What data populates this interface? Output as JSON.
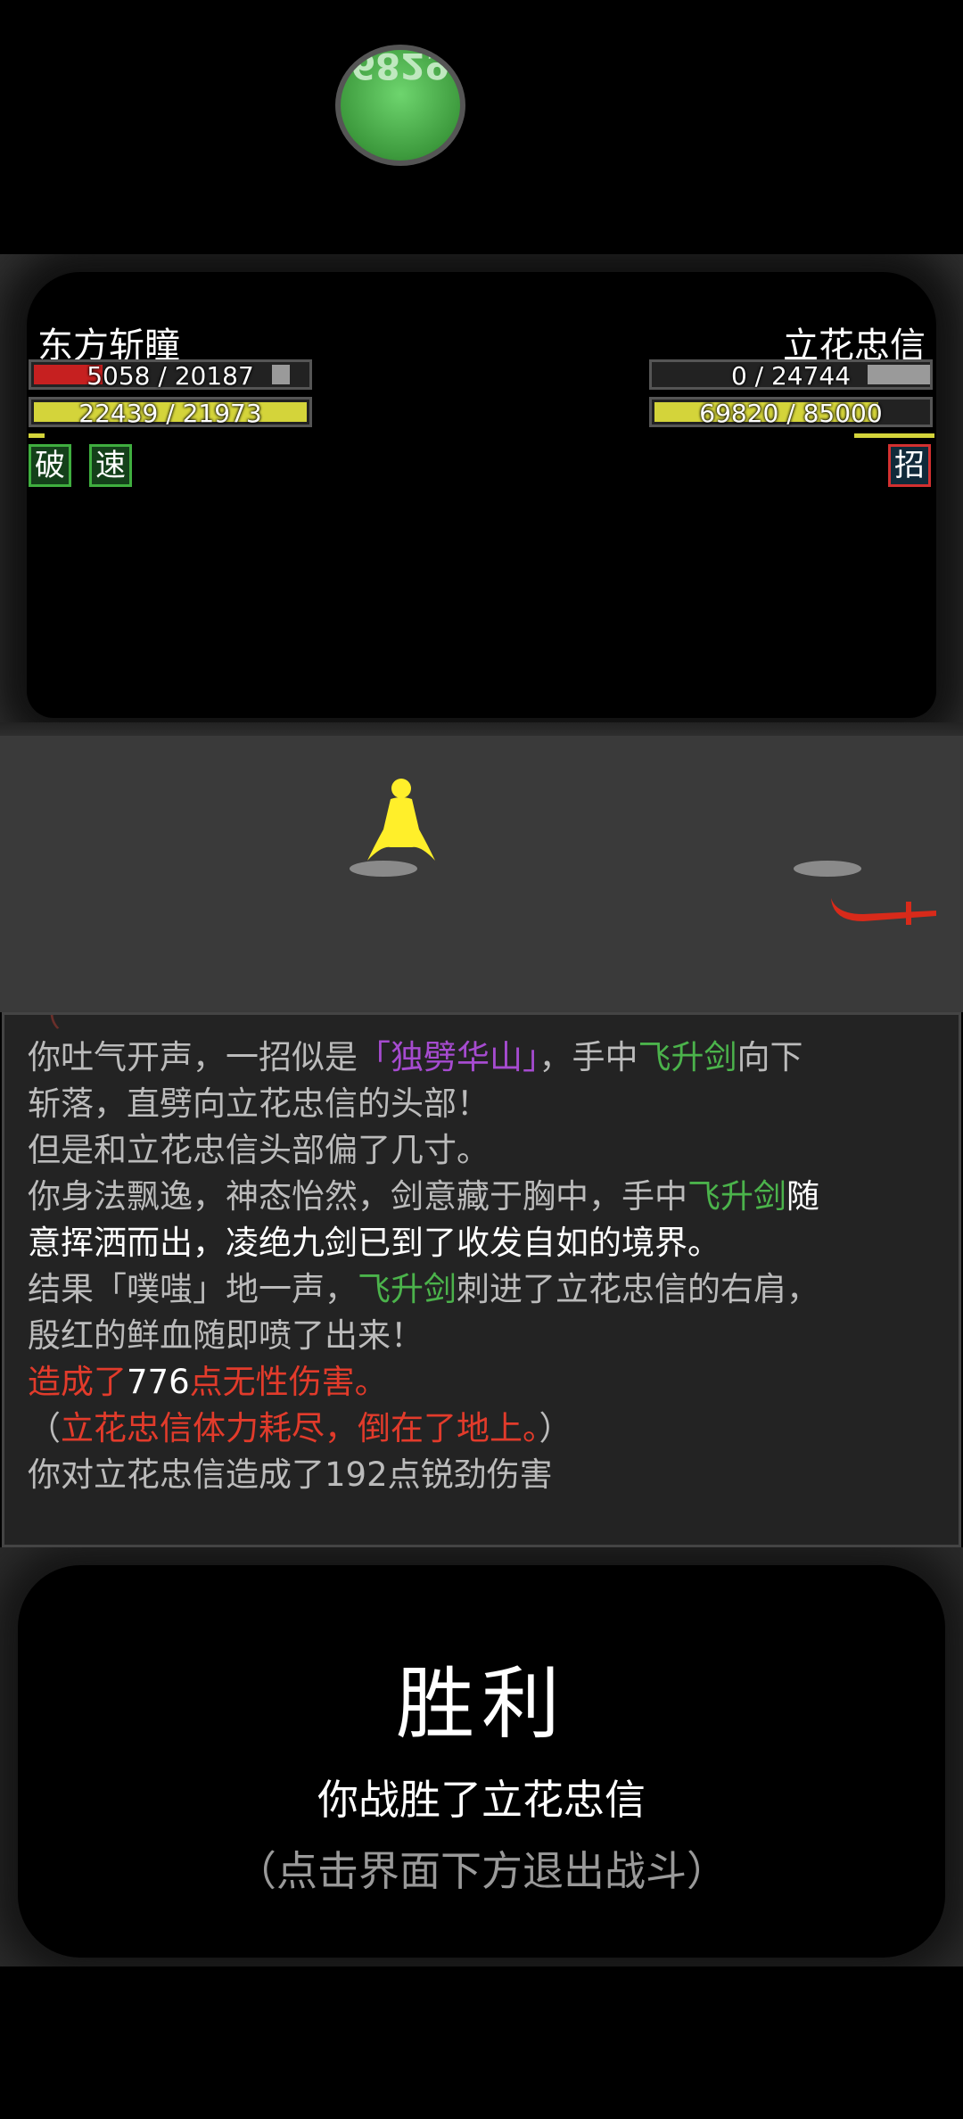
{
  "coin_label": "6829",
  "player": {
    "name": "东方斩瞳",
    "hp_text": "5058 / 20187",
    "hp_fraction": 0.25,
    "mp_text": "22439 / 21973",
    "mp_fraction": 1.0,
    "statuses": [
      "破",
      "速"
    ]
  },
  "enemy": {
    "name": "立花忠信",
    "hp_text": "0 / 24744",
    "hp_fraction": 0.0,
    "mp_text": "69820 / 85000",
    "mp_fraction": 0.82,
    "statuses": [
      "招"
    ]
  },
  "colors": {
    "hp": "#c62020",
    "mp": "#d4d43a",
    "status_player": "#3fae3f",
    "status_enemy": "#d23030",
    "figure": "#ffef2a",
    "weapon": "#d82a1a"
  },
  "log": {
    "line1_a": "你吐气开声，一招似是",
    "line1_b": "「独劈华山」",
    "line1_c": "，手中",
    "line1_d": "飞升剑",
    "line1_e": "向下",
    "line2": "斩落，直劈向立花忠信的头部！",
    "line3": "但是和立花忠信头部偏了几寸。",
    "line4_a": "你身法飘逸，神态怡然，剑意藏于胸中，手中",
    "line4_b": "飞升剑",
    "line4_c": "随",
    "line5": "意挥洒而出，凌绝九剑已到了收发自如的境界。",
    "line6_a": "结果「噗嗤」地一声，",
    "line6_b": "飞升剑",
    "line6_c": "刺进了立花忠信的右肩，",
    "line7": "殷红的鲜血随即喷了出来！",
    "line8_a": "造成了",
    "line8_b": "776",
    "line8_c": "点无性伤害。",
    "line9_a": "（",
    "line9_b": "立花忠信体力耗尽，倒在了地上。",
    "line9_c": "）",
    "line10": "你对立花忠信造成了192点锐劲伤害"
  },
  "result": {
    "title": "胜利",
    "subtitle": "你战胜了立花忠信",
    "hint": "（点击界面下方退出战斗）"
  }
}
